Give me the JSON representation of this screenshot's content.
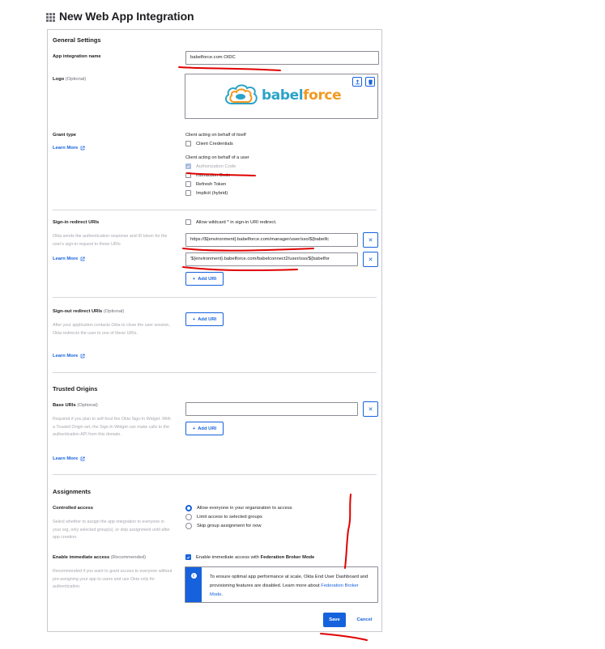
{
  "page": {
    "title": "New Web App Integration"
  },
  "general": {
    "section_title": "General Settings",
    "app_name_label": "App integration name",
    "app_name_value": "babelforce.com OIDC",
    "logo_label": "Logo",
    "logo_optional": "(Optional)",
    "logo_brand": {
      "part1": "babel",
      "part2": "force"
    }
  },
  "grant": {
    "label": "Grant type",
    "learn_more": "Learn More",
    "self_heading": "Client acting on behalf of itself",
    "user_heading": "Client acting on behalf of a user",
    "options": [
      {
        "label": "Client Credentials",
        "checked": false
      },
      {
        "label": "Authorization Code",
        "checked": true,
        "disabled": true
      },
      {
        "label": "Interaction Code",
        "checked": false
      },
      {
        "label": "Refresh Token",
        "checked": false
      },
      {
        "label": "Implicit (hybrid)",
        "checked": false
      }
    ]
  },
  "signin": {
    "label": "Sign-in redirect URIs",
    "wildcard_label": "Allow wildcard * in sign-in URI redirect.",
    "help": "Okta sends the authentication response and ID token for the user's sign-in request to these URIs",
    "learn_more": "Learn More",
    "uris": [
      "https://${environment}.babelforce.com/manager/user/sso/${babelfc",
      "'${environment}.babelforce.com/babelconnect2/user/sso/${babelfor"
    ],
    "add_uri": "Add URI"
  },
  "signout": {
    "label": "Sign-out redirect URIs",
    "optional": "(Optional)",
    "help": "After your application contacts Okta to close the user session, Okta redirects the user to one of these URIs.",
    "learn_more": "Learn More",
    "add_uri": "Add URI"
  },
  "trusted": {
    "section_title": "Trusted Origins",
    "label": "Base URIs",
    "optional": "(Optional)",
    "help": "Required if you plan to self-host the Okta Sign-In Widget. With a Trusted Origin set, the Sign-In Widget can make calls to the authentication API from this domain.",
    "learn_more": "Learn More",
    "value": "",
    "add_uri": "Add URI"
  },
  "assignments": {
    "section_title": "Assignments",
    "controlled_label": "Controlled access",
    "controlled_help": "Select whether to assign the app integration to everyone in your org, only selected group(s), or skip assignment until after app creation.",
    "options": [
      {
        "label": "Allow everyone in your organization to access",
        "checked": true
      },
      {
        "label": "Limit access to selected groups",
        "checked": false
      },
      {
        "label": "Skip group assignment for now",
        "checked": false
      }
    ],
    "immediate_label": "Enable immediate access",
    "immediate_recommended": "(Recommended)",
    "immediate_help": "Recommended if you want to grant access to everyone without pre-assigning your app to users and use Okta only for authentication.",
    "immediate_check_prefix": "Enable immediate access with ",
    "immediate_check_bold": "Federation Broker Mode",
    "callout_text": "To ensure optimal app performance at scale, Okta End User Dashboard and provisioning features are disabled. Learn more about ",
    "callout_link": "Federation Broker Mode",
    "callout_end": "."
  },
  "footer": {
    "save": "Save",
    "cancel": "Cancel"
  },
  "colors": {
    "accent": "#1662dd",
    "annotation": "#e00000",
    "brand_blue": "#2ba3c8",
    "brand_orange": "#f29a21"
  }
}
